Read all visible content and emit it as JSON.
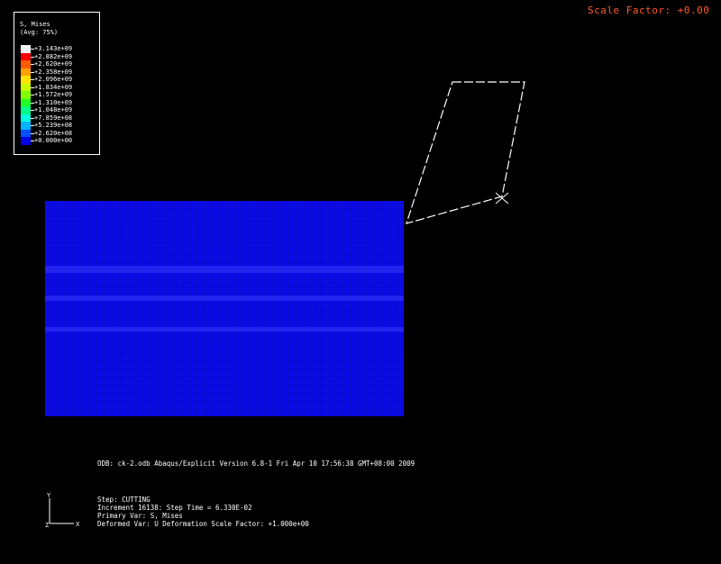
{
  "viewport": {
    "scale_factor_text": "Scale Factor: +0.00"
  },
  "legend": {
    "title_line1": "S, Mises",
    "title_line2": "(Avg: 75%)",
    "entries": [
      {
        "value": "+3.143e+09",
        "color": "#f2f2f2"
      },
      {
        "value": "+2.882e+09",
        "color": "#ff0000"
      },
      {
        "value": "+2.620e+09",
        "color": "#ff5a00"
      },
      {
        "value": "+2.358e+09",
        "color": "#ff9f00"
      },
      {
        "value": "+2.096e+09",
        "color": "#ffe400"
      },
      {
        "value": "+1.834e+09",
        "color": "#c8ff00"
      },
      {
        "value": "+1.572e+09",
        "color": "#7fff00"
      },
      {
        "value": "+1.310e+09",
        "color": "#22ff22"
      },
      {
        "value": "+1.048e+09",
        "color": "#00ff86"
      },
      {
        "value": "+7.859e+08",
        "color": "#00ffe0"
      },
      {
        "value": "+5.239e+08",
        "color": "#00b4ff"
      },
      {
        "value": "+2.620e+08",
        "color": "#0050ff"
      },
      {
        "value": "+0.000e+00",
        "color": "#0000e6"
      }
    ]
  },
  "model": {
    "mesh_color": "#1010ff",
    "mesh_line_color": "#0000a0",
    "tool_outline_color": "#ffffff"
  },
  "info": {
    "line1": "ODB: ck-2.odb    Abaqus/Explicit Version 6.8-1    Fri Apr 10 17:56:38 GMT+08:00 2009"
  },
  "status": {
    "step": "Step: CUTTING",
    "increment": "Increment    16138: Step Time =   6.330E-02",
    "primary_var": "Primary Var: S, Mises",
    "deformed_var": "Deformed Var: U   Deformation Scale Factor: +1.000e+00"
  },
  "triad": {
    "y_label": "Y",
    "x_label": "X",
    "z_label": "Z"
  }
}
